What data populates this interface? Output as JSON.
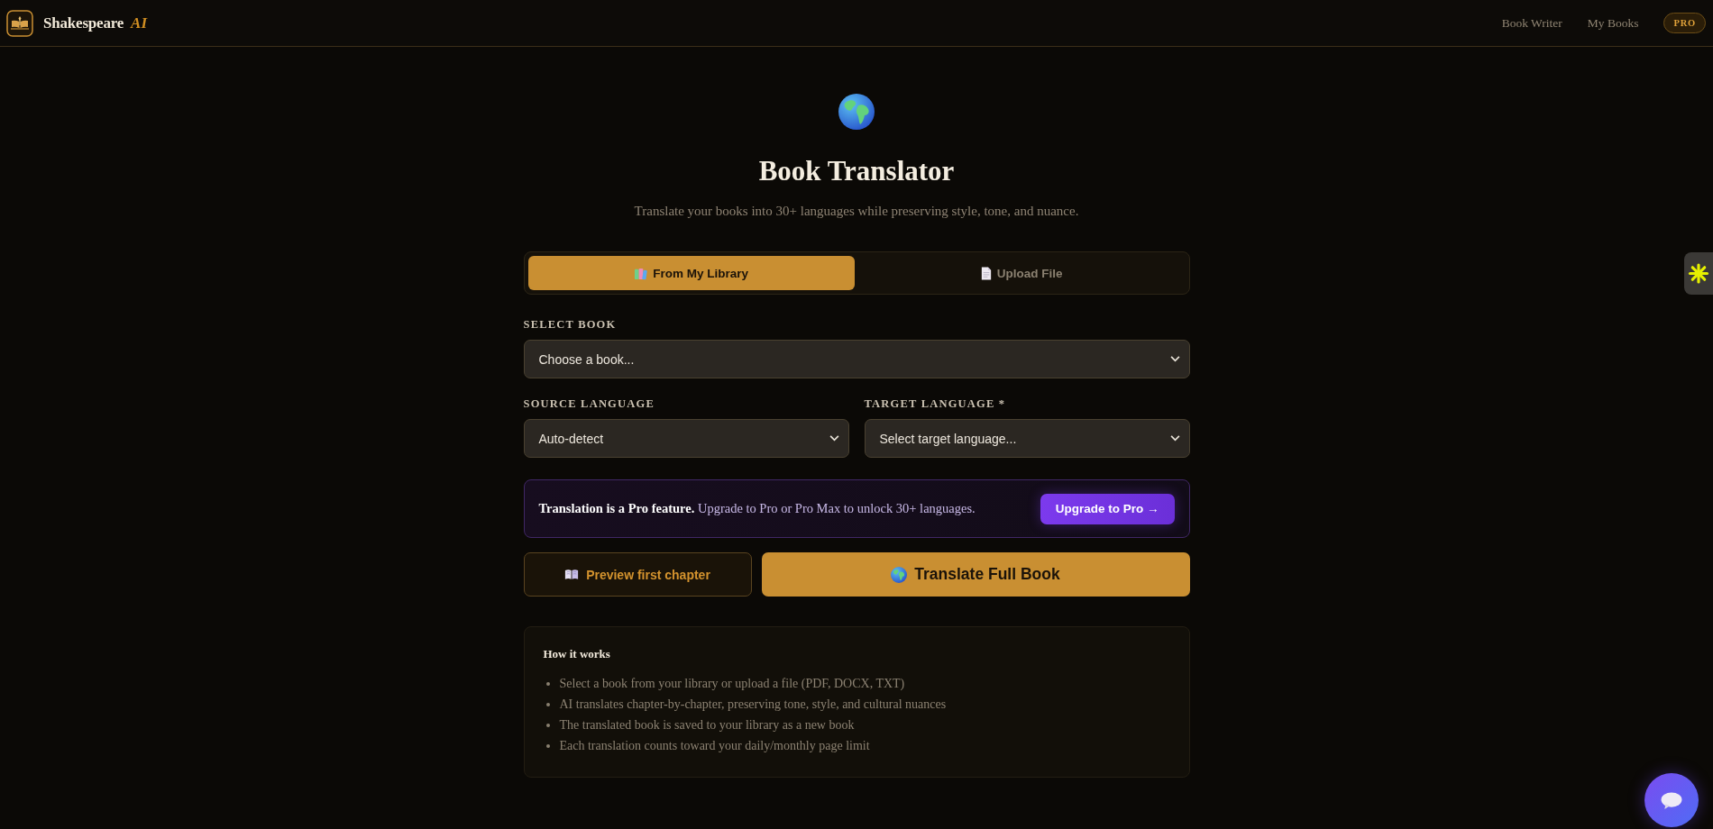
{
  "header": {
    "brand": "Shakespeare",
    "brand_suffix": "AI",
    "nav": [
      {
        "label": "Book Writer"
      },
      {
        "label": "My Books"
      }
    ],
    "badge": "PRO"
  },
  "hero": {
    "title": "Book Translator",
    "subtitle": "Translate your books into 30+ languages while preserving style, tone, and nuance."
  },
  "tabs": [
    {
      "kind": "library",
      "label": "From My Library",
      "selected": true
    },
    {
      "kind": "file",
      "label": "Upload File",
      "selected": false
    }
  ],
  "book_field": {
    "label": "SELECT BOOK",
    "value": "Choose a book..."
  },
  "language_fields": [
    {
      "label": "SOURCE LANGUAGE",
      "value": "Auto-detect"
    },
    {
      "label": "TARGET LANGUAGE *",
      "value": "Select target language..."
    }
  ],
  "pro_notice": {
    "text": "**Translation is a Pro feature.** Upgrade to Pro or Pro Max to unlock 30+ languages.",
    "button": "Upgrade to Pro →"
  },
  "actions": [
    {
      "kind": "secondary",
      "label": "Preview first chapter"
    },
    {
      "kind": "primary",
      "label": "Translate Full Book"
    }
  ],
  "how_it_works": {
    "title": "How it works",
    "items": [
      "Select a book from your library or upload a file (PDF, DOCX, TXT)",
      "AI translates chapter-by-chapter, preserving tone, style, and cultural nuances",
      "The translated book is saved to your library as a new book",
      "Each translation counts toward your daily/monthly page limit"
    ]
  }
}
